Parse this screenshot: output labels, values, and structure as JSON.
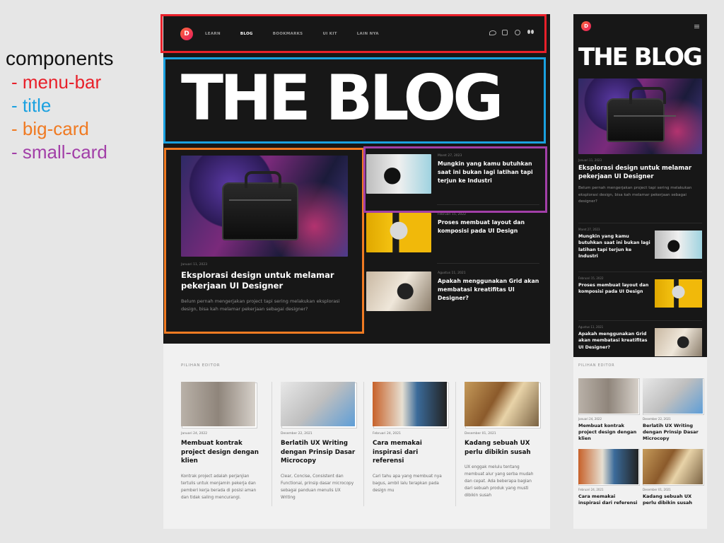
{
  "legend": {
    "title": "components",
    "items": [
      {
        "label": "- menu-bar",
        "color": "#e8202a"
      },
      {
        "label": "- title",
        "color": "#1aa1e0"
      },
      {
        "label": "- big-card",
        "color": "#f07a22"
      },
      {
        "label": "- small-card",
        "color": "#a23fa8"
      }
    ]
  },
  "nav": {
    "logo": "D",
    "items": [
      "LEARN",
      "BLOG",
      "BOOKMARKS",
      "UI KIT",
      "LAIN NYA"
    ],
    "active": "BLOG",
    "social_icons": [
      "twitter-icon",
      "instagram-icon",
      "dribbble-icon",
      "medium-icon"
    ]
  },
  "title": "THE BLOG",
  "big_card": {
    "date": "Januari 11, 2023",
    "title": "Eksplorasi design untuk melamar pekerjaan UI Designer",
    "excerpt": "Belum pernah mengerjakan project tapi sering melakukan eksplorasi design, bisa kah melamar pekerjaan sebagai designer?"
  },
  "small_cards": [
    {
      "date": "Maret 27, 2023",
      "title": "Mungkin yang kamu butuhkan saat ini bukan lagi latihan tapi terjun ke Industri"
    },
    {
      "date": "Februari 15, 2022",
      "title": "Proses membuat layout dan komposisi pada UI Design"
    },
    {
      "date": "Agustus 11, 2021",
      "title": "Apakah menggunakan Grid akan membatasi kreatifitas UI Designer?"
    }
  ],
  "editor": {
    "heading": "PILIHAN EDITOR",
    "cards": [
      {
        "date": "Januari 24, 2022",
        "title": "Membuat kontrak project design dengan klien",
        "excerpt": "Kontrak project adalah perjanjian tertulis untuk menjamin pekerja dan pemberi kerja berada di posisi aman dan tidak saling mencurangi."
      },
      {
        "date": "Desember 22, 2021",
        "title": "Berlatih UX Writing dengan Prinsip Dasar Microcopy",
        "excerpt": "Clear, Concise, Consistent dan Functional, prinsip dasar microcopy sebagai panduan menulis UX Writing"
      },
      {
        "date": "Februari 24, 2021",
        "title": "Cara memakai inspirasi dari referensi",
        "excerpt": "Cari tahu apa yang membuat nya bagus, ambil lalu terapkan pada design mu"
      },
      {
        "date": "Desember 01, 2021",
        "title": "Kadang sebuah UX perlu dibikin susah",
        "excerpt": "UX enggak melulu tentang membuat alur yang serba mudah dan cepat. Ada beberapa bagian dari sebuah produk yang musti dibikin susah"
      }
    ]
  },
  "mobile": {
    "logo": "D",
    "title": "THE BLOG",
    "big_card": {
      "date": "Januari 11, 2023",
      "title": "Eksplorasi design untuk melamar pekerjaan UI Designer",
      "excerpt": "Belum pernah mengerjakan project tapi sering melakukan eksplorasi design, bisa kah melamar pekerjaan sebagai designer?"
    },
    "list": [
      {
        "date": "Maret 27, 2023",
        "title": "Mungkin yang kamu butuhkan saat ini bukan lagi latihan tapi terjun ke Industri"
      },
      {
        "date": "Februari 15, 2022",
        "title": "Proses membuat layout dan komposisi pada UI Design"
      },
      {
        "date": "Agustus 11, 2021",
        "title": "Apakah menggunakan Grid akan membatasi kreatifitas UI Designer?"
      }
    ],
    "editor_heading": "PILIHAN EDITOR",
    "editor": [
      {
        "date": "Januari 24, 2022",
        "title": "Membuat kontrak project design dengan klien"
      },
      {
        "date": "Desember 22, 2021",
        "title": "Berlatih UX Writing dengan Prinsip Dasar Microcopy"
      },
      {
        "date": "Februari 24, 2021",
        "title": "Cara memakai inspirasi dari referensi"
      },
      {
        "date": "Desember 01, 2021",
        "title": "Kadang sebuah UX perlu dibikin susah"
      }
    ]
  },
  "colors": {
    "dark_bg": "#171717",
    "light_bg": "#f1f1f1",
    "logo_gradient_start": "#ff6a3d",
    "logo_gradient_end": "#e51b5c"
  }
}
